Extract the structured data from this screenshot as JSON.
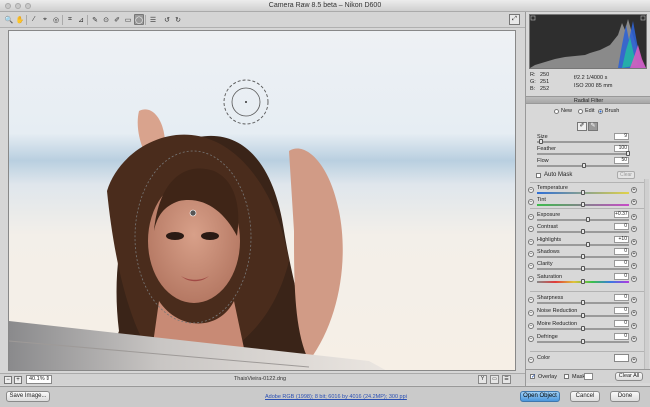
{
  "window": {
    "title": "Camera Raw 8.5 beta  –  Nikon D600"
  },
  "toolbar": {
    "tools": [
      {
        "name": "zoom-tool",
        "glyph": "🔍"
      },
      {
        "name": "hand-tool",
        "glyph": "✋"
      },
      {
        "name": "white-balance-tool",
        "glyph": "⁄"
      },
      {
        "name": "color-sampler-tool",
        "glyph": "⌖"
      },
      {
        "name": "targeted-adjustment-tool",
        "glyph": "◎"
      },
      {
        "name": "crop-tool",
        "glyph": "⌗"
      },
      {
        "name": "straighten-tool",
        "glyph": "⊿"
      },
      {
        "name": "spot-removal-tool",
        "glyph": "✎"
      },
      {
        "name": "red-eye-tool",
        "glyph": "⊙"
      },
      {
        "name": "adjustment-brush-tool",
        "glyph": "✐"
      },
      {
        "name": "graduated-filter-tool",
        "glyph": "▭"
      },
      {
        "name": "radial-filter-tool",
        "glyph": "◯"
      },
      {
        "name": "preferences-tool",
        "glyph": "☰"
      },
      {
        "name": "rotate-ccw-tool",
        "glyph": "↺"
      },
      {
        "name": "rotate-cw-tool",
        "glyph": "↻"
      }
    ],
    "active_tool": "radial-filter-tool",
    "fullscreen_glyph": "⤢"
  },
  "status": {
    "zoom_minus": "−",
    "zoom_plus": "+",
    "zoom": "40.1%",
    "filename": "ThaisVieira-0122.dng",
    "view_glyphs": [
      "Y",
      "▭",
      "☰"
    ]
  },
  "bottom": {
    "save_label": "Save Image...",
    "workflow_link": "Adobe RGB (1998); 8 bit; 6016 by 4016 (24.2MP); 300 ppi",
    "open_label": "Open Object",
    "cancel_label": "Cancel",
    "done_label": "Done"
  },
  "info": {
    "r_label": "R:",
    "r": "250",
    "g_label": "G:",
    "g": "251",
    "b_label": "B:",
    "b": "252",
    "aperture_shutter": "f/2.2   1/4000 s",
    "iso_focal": "ISO 200   85 mm"
  },
  "panel": {
    "title": "Radial Filter",
    "modes": {
      "new": "New",
      "edit": "Edit",
      "brush": "Brush",
      "selected": "brush"
    },
    "brush_icons": [
      "✐",
      "✎"
    ],
    "brush": {
      "size_label": "Size",
      "size": "9",
      "feather_label": "Feather",
      "feather": "100",
      "flow_label": "Flow",
      "flow": "50",
      "automask_label": "Auto Mask",
      "clear_label": "Clear"
    },
    "adjustments": [
      {
        "label": "Temperature",
        "value": "",
        "pos": 0.5,
        "name": "temperature"
      },
      {
        "label": "Tint",
        "value": "",
        "pos": 0.5,
        "name": "tint"
      },
      {
        "label": "Exposure",
        "value": "+0.37",
        "pos": 0.55,
        "name": "exposure"
      },
      {
        "label": "Contrast",
        "value": "0",
        "pos": 0.5,
        "name": "contrast"
      },
      {
        "label": "Highlights",
        "value": "+10",
        "pos": 0.55,
        "name": "highlights"
      },
      {
        "label": "Shadows",
        "value": "0",
        "pos": 0.5,
        "name": "shadows"
      },
      {
        "label": "Clarity",
        "value": "0",
        "pos": 0.5,
        "name": "clarity"
      },
      {
        "label": "Saturation",
        "value": "0",
        "pos": 0.5,
        "name": "saturation"
      },
      {
        "label": "Sharpness",
        "value": "0",
        "pos": 0.5,
        "name": "sharpness"
      },
      {
        "label": "Noise Reduction",
        "value": "0",
        "pos": 0.5,
        "name": "noise-reduction"
      },
      {
        "label": "Moire Reduction",
        "value": "0",
        "pos": 0.5,
        "name": "moire-reduction"
      },
      {
        "label": "Defringe",
        "value": "0",
        "pos": 0.5,
        "name": "defringe"
      }
    ],
    "color_label": "Color",
    "overlay_label": "Overlay",
    "mask_label": "Mask",
    "clear_all_label": "Clear All"
  }
}
